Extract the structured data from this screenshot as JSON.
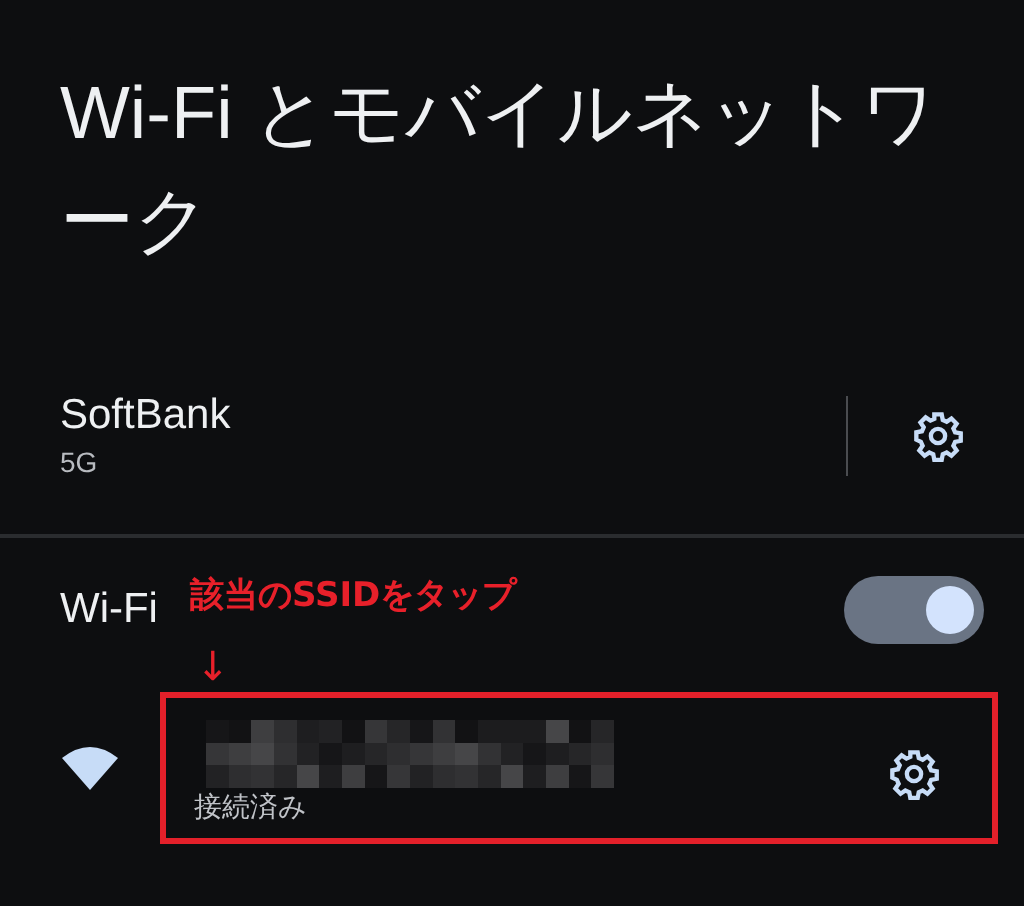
{
  "title": "Wi-Fi とモバイルネットワーク",
  "mobile_network": {
    "name": "SoftBank",
    "type": "5G"
  },
  "wifi": {
    "label": "Wi-Fi",
    "on": true
  },
  "annotation": {
    "text": "該当のSSIDをタップ",
    "arrow": "↓"
  },
  "networks": [
    {
      "status": "接続済み"
    }
  ]
}
